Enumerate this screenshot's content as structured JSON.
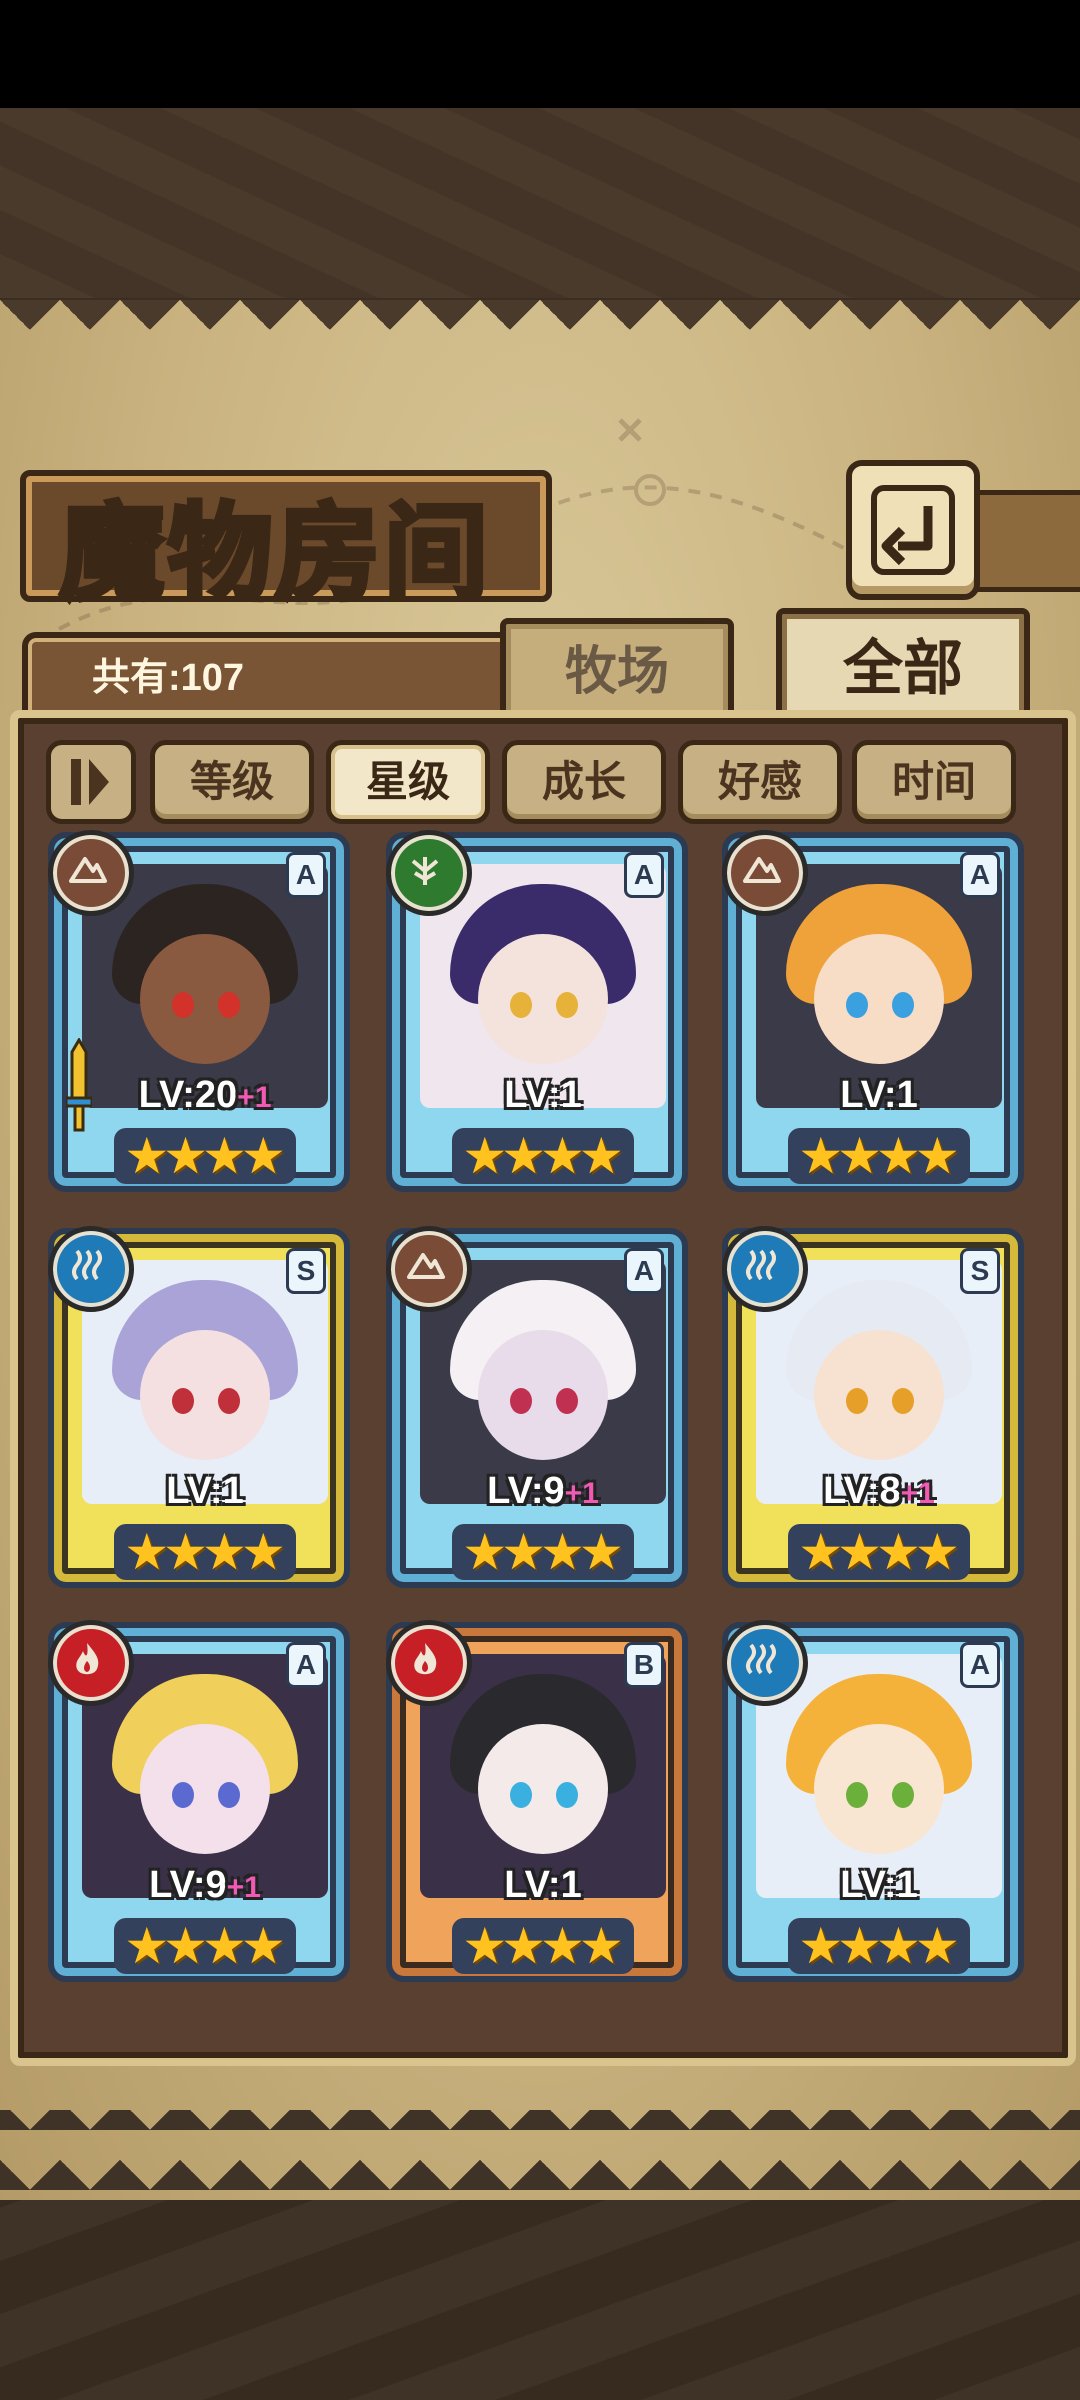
{
  "header": {
    "title": "魔物房间"
  },
  "summary": {
    "total_label": "共有:107"
  },
  "tabs": [
    {
      "label": "牧场",
      "active": false
    },
    {
      "label": "全部",
      "active": true
    }
  ],
  "sort_buttons": [
    {
      "label": "等级",
      "active": false
    },
    {
      "label": "星级",
      "active": true
    },
    {
      "label": "成长",
      "active": false
    },
    {
      "label": "好感",
      "active": false
    },
    {
      "label": "时间",
      "active": false
    }
  ],
  "monsters": [
    {
      "rank": "A",
      "element": "earth",
      "level": "LV:20",
      "bonus": "+1",
      "stars": 4,
      "equipped_icon": "sword-icon",
      "hair": "#2b2420",
      "skin": "#8a5a40",
      "eyes": "#d2322a"
    },
    {
      "rank": "A",
      "element": "wood",
      "level": "LV:1",
      "bonus": "",
      "stars": 4,
      "hair": "#3a2c6a",
      "skin": "#f4e2dc",
      "eyes": "#e6b23a"
    },
    {
      "rank": "A",
      "element": "earth",
      "level": "LV:1",
      "bonus": "",
      "stars": 4,
      "hair": "#f0a23a",
      "skin": "#f7dcc6",
      "eyes": "#3aa0e0"
    },
    {
      "rank": "S",
      "element": "water",
      "level": "LV:1",
      "bonus": "",
      "stars": 4,
      "hair": "#a9a3d8",
      "skin": "#f4e0e0",
      "eyes": "#c0303a"
    },
    {
      "rank": "A",
      "element": "earth",
      "level": "LV:9",
      "bonus": "+1",
      "stars": 4,
      "hair": "#f4f0f4",
      "skin": "#e8dcea",
      "eyes": "#c03050"
    },
    {
      "rank": "S",
      "element": "water",
      "level": "LV:8",
      "bonus": "+1",
      "stars": 4,
      "hair": "#e6eaf2",
      "skin": "#f7e2d2",
      "eyes": "#e6a02a"
    },
    {
      "rank": "A",
      "element": "fire",
      "level": "LV:9",
      "bonus": "+1",
      "stars": 4,
      "hair": "#f0cf5a",
      "skin": "#f4e0ea",
      "eyes": "#5a6ad0"
    },
    {
      "rank": "B",
      "element": "fire",
      "level": "LV:1",
      "bonus": "",
      "stars": 4,
      "hair": "#2a2a2e",
      "skin": "#f4eaea",
      "eyes": "#3ab0e0"
    },
    {
      "rank": "A",
      "element": "water",
      "level": "LV:1",
      "bonus": "",
      "stars": 4,
      "hair": "#f4b23a",
      "skin": "#f9e6d2",
      "eyes": "#6ab03a"
    }
  ]
}
